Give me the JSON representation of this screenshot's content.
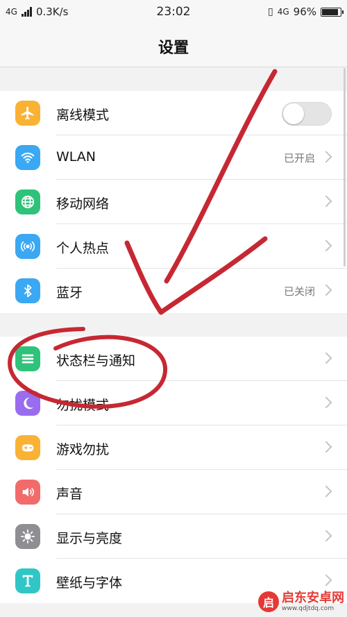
{
  "status_bar": {
    "network_left": "4G",
    "speed": "0.3K/s",
    "time": "23:02",
    "network_right": "4G",
    "battery": "96%",
    "battery_level": 0.96
  },
  "header": {
    "title": "设置"
  },
  "groups": [
    {
      "items": [
        {
          "label": "离线模式",
          "icon": "airplane-icon",
          "color": "#f9b233",
          "control": "toggle",
          "toggle_on": false
        },
        {
          "label": "WLAN",
          "icon": "wifi-icon",
          "color": "#3aa8f3",
          "value": "已开启"
        },
        {
          "label": "移动网络",
          "icon": "globe-icon",
          "color": "#2fc27a"
        },
        {
          "label": "个人热点",
          "icon": "hotspot-icon",
          "color": "#3aa8f3"
        },
        {
          "label": "蓝牙",
          "icon": "bluetooth-icon",
          "color": "#3aa8f3",
          "value": "已关闭"
        }
      ]
    },
    {
      "items": [
        {
          "label": "状态栏与通知",
          "icon": "statusbar-icon",
          "color": "#2fc27a"
        },
        {
          "label": "勿扰模式",
          "icon": "moon-icon",
          "color": "#9a6cf0"
        },
        {
          "label": "游戏勿扰",
          "icon": "gamepad-icon",
          "color": "#f9b233"
        },
        {
          "label": "声音",
          "icon": "speaker-icon",
          "color": "#f26b6b"
        },
        {
          "label": "显示与亮度",
          "icon": "sun-icon",
          "color": "#8e8e93"
        },
        {
          "label": "壁纸与字体",
          "icon": "font-icon",
          "color": "#30c6c6"
        }
      ]
    }
  ],
  "watermark": {
    "logo_char": "启",
    "name": "启东安卓网",
    "url": "www.qdjtdq.com"
  }
}
